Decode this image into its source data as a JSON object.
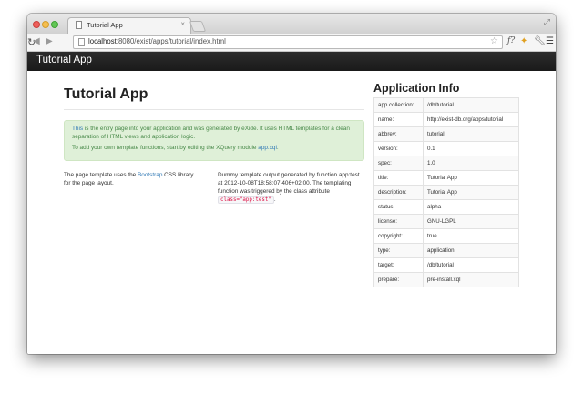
{
  "browser": {
    "tab_title": "Tutorial App",
    "tab_close": "×",
    "url_host": "localhost",
    "url_rest": ":8080/exist/apps/tutorial/index.html",
    "icons": {
      "back": "arrow-left-icon",
      "forward": "arrow-right-icon",
      "reload": "reload-icon",
      "star": "star-icon",
      "menu": "menu-icon"
    }
  },
  "page": {
    "brand": "Tutorial App",
    "title": "Tutorial App",
    "alert": {
      "p1_link": "This",
      "p1_text": " is the entry page into your application and was generated by eXide. It uses HTML templates for a clean separation of HTML views and application logic.",
      "p2_text": "To add your own template functions, start by editing the XQuery module ",
      "p2_link": "app.xql",
      "p2_end": "."
    },
    "left": {
      "text1": "The page template uses the ",
      "link": "Bootstrap",
      "text2": " CSS library for the page layout."
    },
    "middle": {
      "text": "Dummy template output generated by function app:test at 2012-10-08T18:58:07.406+02:00. The templating function was triggered by the class attribute ",
      "code": "class=\"app:test\"",
      "end": "."
    },
    "info_title": "Application Info",
    "info_rows": [
      {
        "key": "app collection:",
        "value": "/db/tutorial"
      },
      {
        "key": "name:",
        "value": "http://exist-db.org/apps/tutorial"
      },
      {
        "key": "abbrev:",
        "value": "tutorial"
      },
      {
        "key": "version:",
        "value": "0.1"
      },
      {
        "key": "spec:",
        "value": "1.0"
      },
      {
        "key": "title:",
        "value": "Tutorial App"
      },
      {
        "key": "description:",
        "value": "Tutorial App"
      },
      {
        "key": "status:",
        "value": "alpha"
      },
      {
        "key": "license:",
        "value": "GNU-LGPL"
      },
      {
        "key": "copyright:",
        "value": "true"
      },
      {
        "key": "type:",
        "value": "application"
      },
      {
        "key": "target:",
        "value": "/db/tutorial"
      },
      {
        "key": "prepare:",
        "value": "pre-install.xql"
      }
    ]
  },
  "colors": {
    "navbar": "#1a1a1a",
    "alert_bg": "#dff0d8",
    "link": "#3079b5"
  }
}
